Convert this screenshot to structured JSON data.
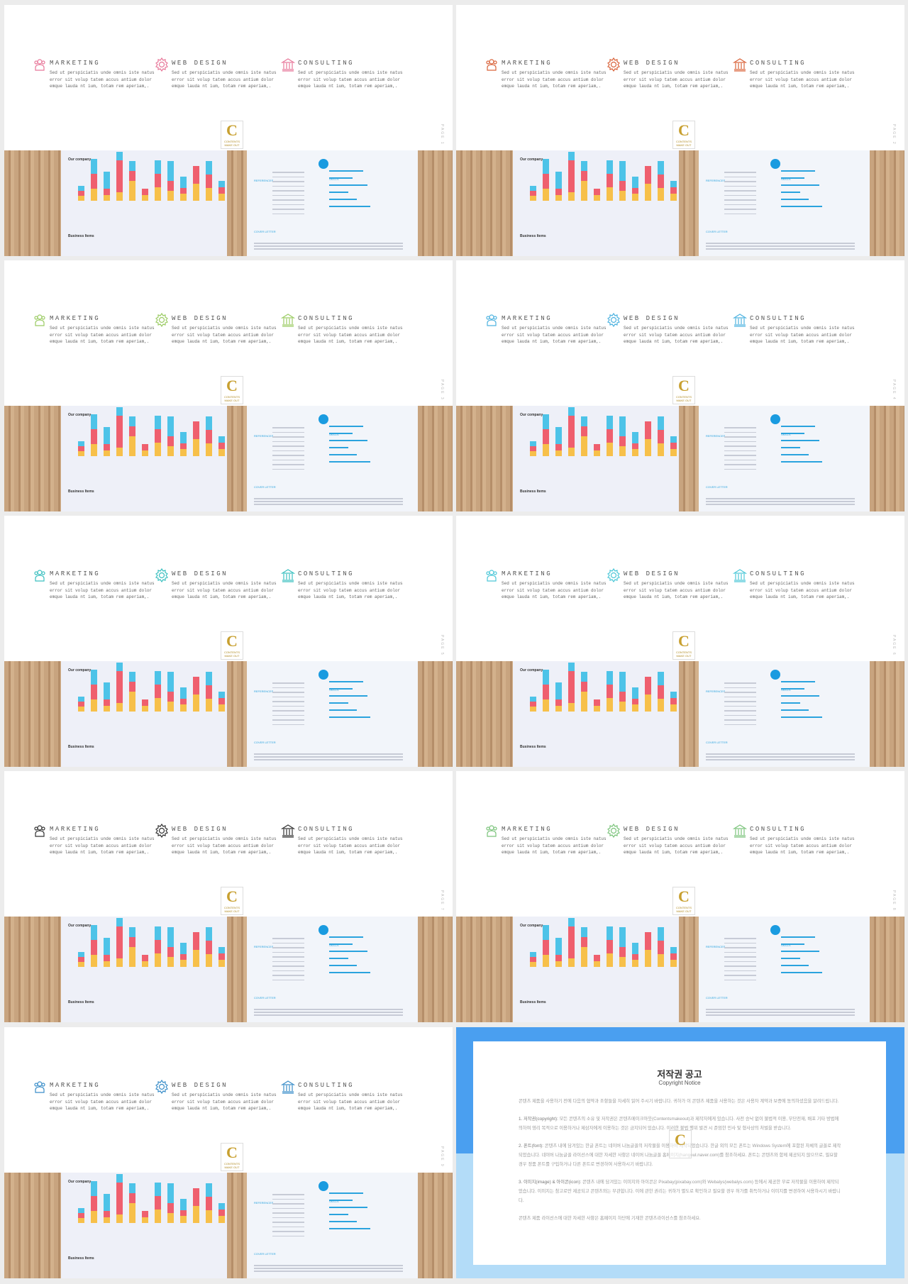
{
  "services_text": "Sed ut perspiciatis unde omnis iste natus error sit volup tatem accus antium dolor emque lauda nt ium, totam rem aperiam,.",
  "service_titles": [
    "MARKETING",
    "WEB DESIGN",
    "CONSULTING"
  ],
  "service_icons": [
    "users-icon",
    "gear-heart-icon",
    "bank-icon"
  ],
  "logo": {
    "letter": "C",
    "word": "CONTENTS",
    "sub": "MAKE OUT"
  },
  "page_label": "PAGE",
  "slides": [
    {
      "accent": "#e8789a",
      "page": "1"
    },
    {
      "accent": "#d9633a",
      "page": "2"
    },
    {
      "accent": "#9ccc65",
      "page": "3"
    },
    {
      "accent": "#4fb3e0",
      "page": "4"
    },
    {
      "accent": "#3cc0c0",
      "page": "5"
    },
    {
      "accent": "#4dc8d8",
      "page": "6"
    },
    {
      "accent": "#333333",
      "page": "7"
    },
    {
      "accent": "#7cc47c",
      "page": "8"
    },
    {
      "accent": "#3b8ec9",
      "page": "9"
    }
  ],
  "photo": {
    "chart_title": "Our company",
    "chart_title2": "Business Items",
    "bar_colors": [
      "#f7c04a",
      "#ef5f6e",
      "#4dc3e8"
    ],
    "bars": [
      [
        1,
        1,
        1
      ],
      [
        2.5,
        3,
        3
      ],
      [
        1.2,
        1.2,
        3.4
      ],
      [
        1.7,
        6.4,
        1.7
      ],
      [
        4,
        2,
        2
      ],
      [
        1.2,
        1.2,
        0
      ],
      [
        2.7,
        2.7,
        2.7
      ],
      [
        2,
        2,
        4
      ],
      [
        1.4,
        1.2,
        2.3
      ],
      [
        3.5,
        3.5,
        0
      ],
      [
        2.6,
        2.7,
        2.7
      ],
      [
        1.4,
        1.3,
        1.3
      ]
    ],
    "resume_refs": "REFERENCES",
    "resume_skills": "SKILLS",
    "resume_cover": "COVER LETTER",
    "skill_levels": [
      0.8,
      0.55,
      0.9,
      0.45,
      0.65,
      0.97
    ]
  },
  "copyright": {
    "title": "저작권 공고",
    "subtitle": "Copyright Notice",
    "intro": "콘텐츠 제품을 사용하기 전에 다음의 협약과 조항들을 자세히 읽어 주시기 바랍니다. 귀하가 이 콘텐츠 제품을 사용하는 것은 사용자 계약과 보증에 동의하셨음을 알려드립니다.",
    "items": [
      {
        "head": "1. 저작권(copyright):",
        "text": " 모든 콘텐츠의 소유 및 저작권은 콘텐츠메이크아웃(Contentsmakeout)과 제작자에게 있습니다. 사전 승낙 없이 불법적 이용, 무단전재, 배포 기타 방법에 의하여 영리 목적으로 이용하거나 제삼자에게 이용하는 것은 금지되어 있습니다. 이러한 불법 행위 발견 시 준엄한 민사 및 형사상의 처벌을 받습니다."
      },
      {
        "head": "2. 폰트(font):",
        "text": " 콘텐츠 내에 담겨있는 한글 폰트는 네이버 나눔글꼴의 저작물을 이용하여 제작되었습니다. 한글 외의 모든 폰트는 Windows System에 포함된 자체의 글꼴로 제작되었습니다. 네이버 나눔글꼴 라이선스에 대한 자세한 사항은 네이버 나눔글꼴 홈페이지(hangeul.naver.com)를 참조하세요. 폰트는 콘텐츠와 함께 제공되지 않으므로, 필요할 경우 정품 폰트를 구입하거나 다른 폰트로 변경하여 사용하시기 바랍니다."
      },
      {
        "head": "3. 이미지(image) & 아이콘(icon):",
        "text": " 콘텐츠 내에 담겨있는 이미지와 아이콘은 Pixabay(pixabay.com)와 Webalys(webalys.com) 등에서 제공한 무료 저작물을 이용하여 제작되었습니다. 이미지는 참고로만 제공되고 콘텐츠와는 무관합니다. 이에 관한 권리는 귀하가 별도로 확인하고 필요할 경우 허가를 취득하거나 이미지를 변경하여 사용하시기 바랍니다."
      }
    ],
    "outro": "콘텐츠 제품 라이선스에 대한 자세한 사항은 홈페이지 하단에 기재한 콘텐츠라이선스를 참조하세요."
  }
}
